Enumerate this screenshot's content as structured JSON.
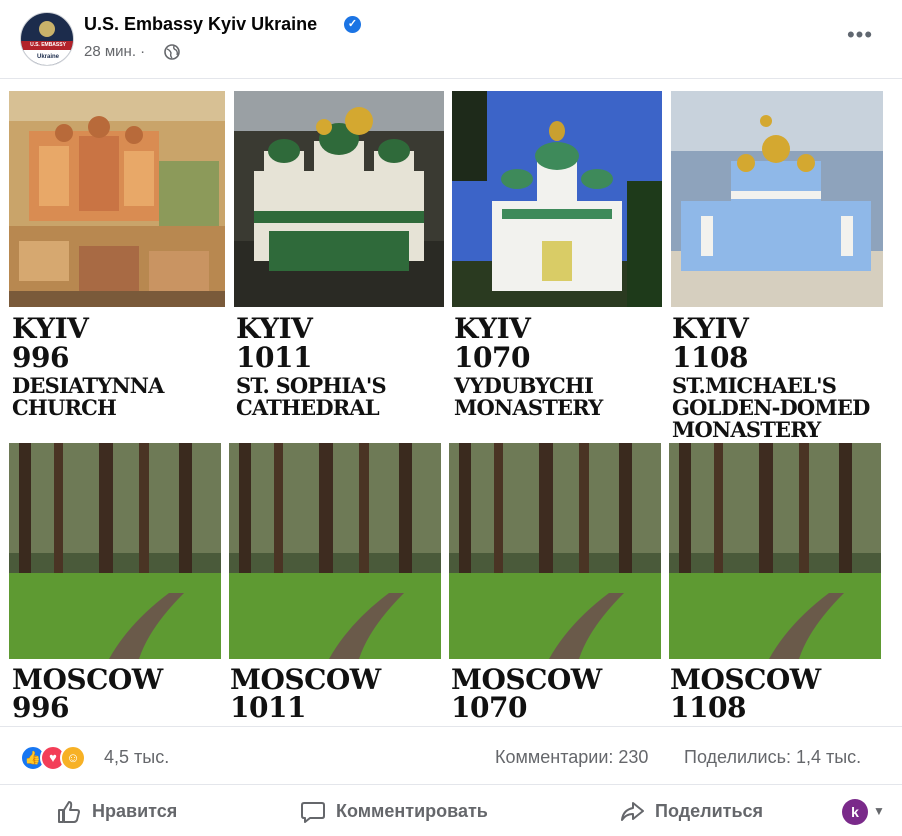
{
  "header": {
    "page_name": "U.S. Embassy Kyiv Ukraine",
    "time": "28 мин. ·",
    "avatar_band": "U.S. EMBASSY",
    "avatar_text": "Ukraine",
    "verified_icon": "verified-check-icon",
    "privacy_icon": "globe-icon",
    "more_icon": "more-options-icon",
    "more_glyph": "•••"
  },
  "image": {
    "top_row": [
      {
        "city": "KYIV",
        "year": "996",
        "name_lines": [
          "DESIATYNNA",
          "CHURCH"
        ]
      },
      {
        "city": "KYIV",
        "year": "1011",
        "name_lines": [
          "ST. SOPHIA'S",
          "CATHEDRAL"
        ]
      },
      {
        "city": "KYIV",
        "year": "1070",
        "name_lines": [
          "VYDUBYCHI",
          "MONASTERY"
        ]
      },
      {
        "city": "KYIV",
        "year": "1108",
        "name_lines": [
          "ST.MICHAEL'S",
          "GOLDEN-DOMED",
          "MONASTERY"
        ]
      }
    ],
    "bottom_row": [
      {
        "city": "MOSCOW",
        "year": "996"
      },
      {
        "city": "MOSCOW",
        "year": "1011"
      },
      {
        "city": "MOSCOW",
        "year": "1070"
      },
      {
        "city": "MOSCOW",
        "year": "1108"
      }
    ]
  },
  "stats": {
    "reaction_icons": [
      "like-icon",
      "love-icon",
      "haha-icon"
    ],
    "reaction_count": "4,5 тыс.",
    "comments": "Комментарии: 230",
    "shares": "Поделились: 1,4 тыс."
  },
  "actions": {
    "like_label": "Нравится",
    "comment_label": "Комментировать",
    "share_label": "Поделиться",
    "profile_initial": "k"
  },
  "colors": {
    "accent": "#1877f2",
    "secondary_text": "#65676b",
    "divider": "#e4e6eb"
  }
}
